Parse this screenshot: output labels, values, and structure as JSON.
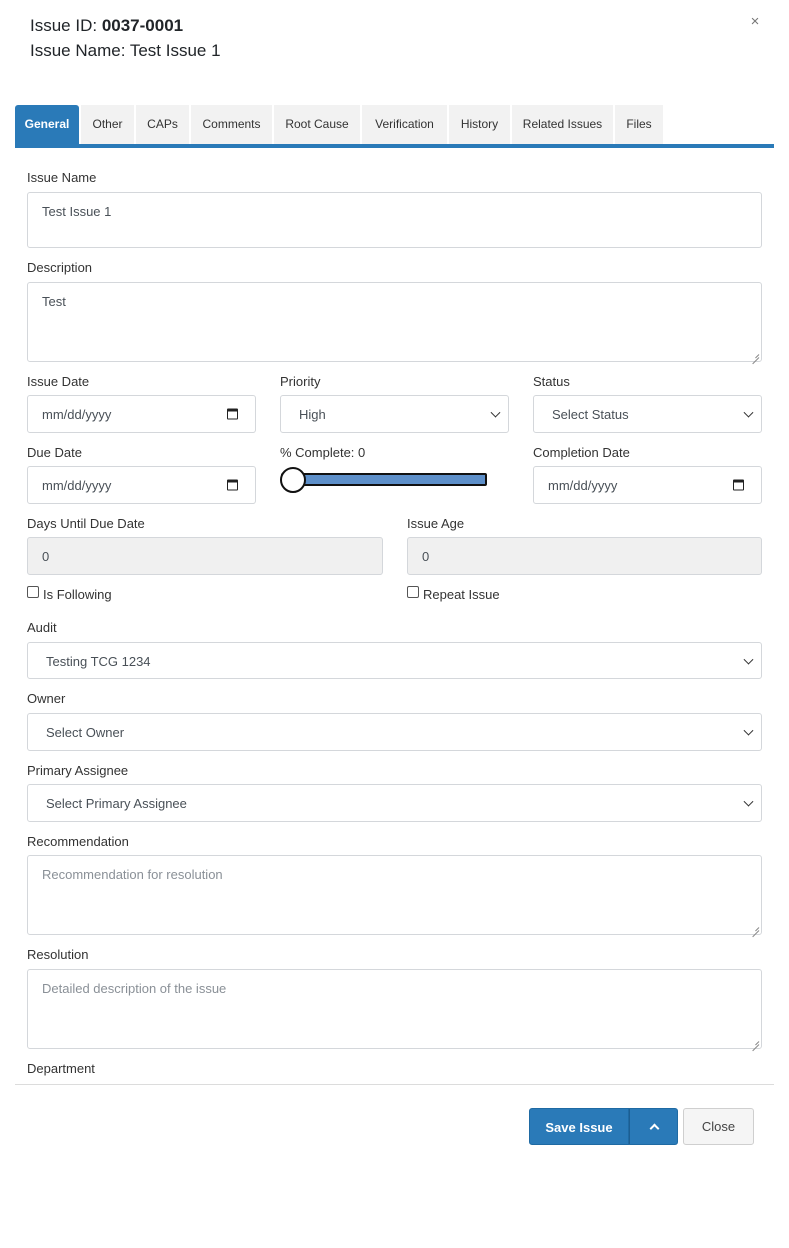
{
  "header": {
    "issue_id_label": "Issue ID: ",
    "issue_id_value": "0037-0001",
    "issue_name_line": "Issue Name: Test Issue 1",
    "close_glyph": "×"
  },
  "tabs": [
    {
      "label": "General",
      "active": true
    },
    {
      "label": "Other"
    },
    {
      "label": "CAPs"
    },
    {
      "label": "Comments"
    },
    {
      "label": "Root Cause"
    },
    {
      "label": "Verification"
    },
    {
      "label": "History"
    },
    {
      "label": "Related Issues"
    },
    {
      "label": "Files"
    }
  ],
  "form": {
    "issue_name": {
      "label": "Issue Name",
      "value": "Test Issue 1"
    },
    "description": {
      "label": "Description",
      "value": "Test"
    },
    "issue_date": {
      "label": "Issue Date",
      "placeholder": "mm/dd/yyyy"
    },
    "priority": {
      "label": "Priority",
      "value": "High"
    },
    "status": {
      "label": "Status",
      "value": "Select Status"
    },
    "due_date": {
      "label": "Due Date",
      "placeholder": "mm/dd/yyyy"
    },
    "percent_complete": {
      "label": "% Complete: 0",
      "value": 0
    },
    "completion_date": {
      "label": "Completion Date",
      "placeholder": "mm/dd/yyyy"
    },
    "days_until_due": {
      "label": "Days Until Due Date",
      "value": "0"
    },
    "issue_age": {
      "label": "Issue Age",
      "value": "0"
    },
    "is_following": {
      "label": "Is Following",
      "checked": false
    },
    "repeat_issue": {
      "label": "Repeat Issue",
      "checked": false
    },
    "audit": {
      "label": "Audit",
      "value": "Testing TCG 1234"
    },
    "owner": {
      "label": "Owner",
      "value": "Select Owner"
    },
    "primary_assignee": {
      "label": "Primary Assignee",
      "value": "Select Primary Assignee"
    },
    "recommendation": {
      "label": "Recommendation",
      "placeholder": "Recommendation for resolution"
    },
    "resolution": {
      "label": "Resolution",
      "placeholder": "Detailed description of the issue"
    },
    "department": {
      "label": "Department"
    }
  },
  "footer": {
    "save_label": "Save Issue",
    "close_label": "Close"
  },
  "colors": {
    "accent": "#2a7ab8",
    "slider_fill": "#5d8fc9"
  }
}
